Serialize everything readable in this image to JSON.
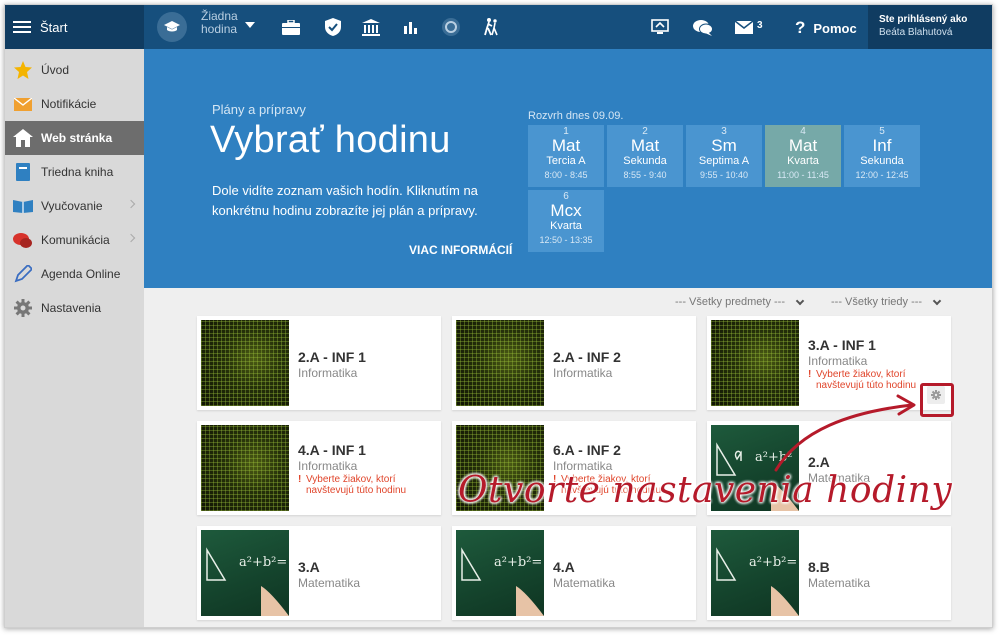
{
  "topbar": {
    "start_label": "Štart",
    "hodina_line1": "Žiadna",
    "hodina_line2": "hodina",
    "message_count": "3",
    "help_label": "Pomoc",
    "user_status": "Ste prihlásený ako",
    "user_name": "Beáta Blahutová"
  },
  "sidebar": {
    "items": [
      {
        "label": "Úvod",
        "icon": "star-icon"
      },
      {
        "label": "Notifikácie",
        "icon": "envelope-icon"
      },
      {
        "label": "Web stránka",
        "icon": "home-icon"
      },
      {
        "label": "Triedna kniha",
        "icon": "book-icon"
      },
      {
        "label": "Vyučovanie",
        "icon": "open-book-icon"
      },
      {
        "label": "Komunikácia",
        "icon": "chat-icon"
      },
      {
        "label": "Agenda Online",
        "icon": "pen-icon"
      },
      {
        "label": "Nastavenia",
        "icon": "gear-icon"
      }
    ]
  },
  "hero": {
    "subtitle": "Plány a prípravy",
    "title": "Vybrať hodinu",
    "description": "Dole vidíte zoznam vašich hodín. Kliknutím na konkrétnu hodinu zobrazíte jej plán a prípravy.",
    "more_link": "VIAC INFORMÁCIÍ",
    "schedule_title": "Rozvrh dnes 09.09.",
    "schedule": [
      {
        "num": "1",
        "subject": "Mat",
        "class": "Tercia A",
        "time": "8:00 - 8:45"
      },
      {
        "num": "2",
        "subject": "Mat",
        "class": "Sekunda",
        "time": "8:55 - 9:40"
      },
      {
        "num": "3",
        "subject": "Sm",
        "class": "Septima A",
        "time": "9:55 - 10:40"
      },
      {
        "num": "4",
        "subject": "Mat",
        "class": "Kvarta",
        "time": "11:00 - 11:45"
      },
      {
        "num": "5",
        "subject": "Inf",
        "class": "Sekunda",
        "time": "12:00 - 12:45"
      },
      {
        "num": "6",
        "subject": "Mcx",
        "class": "Kvarta",
        "time": "12:50 - 13:35"
      }
    ]
  },
  "filters": {
    "subjects": "--- Všetky predmety ---",
    "classes": "--- Všetky triedy ---"
  },
  "cards": [
    {
      "title": "2.A - INF 1",
      "subject": "Informatika",
      "warning": ""
    },
    {
      "title": "2.A - INF 2",
      "subject": "Informatika",
      "warning": ""
    },
    {
      "title": "3.A - INF 1",
      "subject": "Informatika",
      "warning_l1": "Vyberte žiakov, ktorí",
      "warning_l2": "navštevujú túto hodinu"
    },
    {
      "title": "4.A - INF 1",
      "subject": "Informatika",
      "warning_l1": "Vyberte žiakov, ktorí",
      "warning_l2": "navštevujú túto hodinu"
    },
    {
      "title": "6.A - INF 2",
      "subject": "Informatika",
      "warning_l1": "Vyberte žiakov, ktorí",
      "warning_l2": "navštevujú túto hodinu"
    },
    {
      "title": "2.A",
      "subject": "Matematika",
      "warning": ""
    },
    {
      "title": "3.A",
      "subject": "Matematika",
      "warning": ""
    },
    {
      "title": "4.A",
      "subject": "Matematika",
      "warning": ""
    },
    {
      "title": "8.B",
      "subject": "Matematika",
      "warning": ""
    }
  ],
  "annotation": {
    "text": "Otvorte nastavenia hodiny"
  },
  "colors": {
    "topbar": "#164f7d",
    "hero": "#2f80c1",
    "tile": "#4a95d0",
    "tile_current": "#76a9a8",
    "warning": "#e0452b",
    "annotation": "#b51a2a"
  }
}
